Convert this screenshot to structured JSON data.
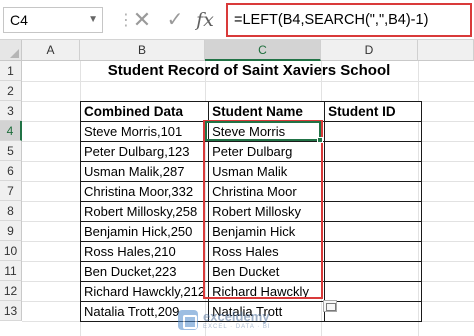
{
  "formula_bar": {
    "name_box": "C4",
    "formula": "=LEFT(B4,SEARCH(\",\",B4)-1)",
    "cancel_icon": "cross-icon",
    "enter_icon": "check-icon",
    "fx_label": "fx"
  },
  "columns": [
    "A",
    "B",
    "C",
    "D"
  ],
  "active_column": "C",
  "rows": [
    "1",
    "2",
    "3",
    "4",
    "5",
    "6",
    "7",
    "8",
    "9",
    "10",
    "11",
    "12",
    "13"
  ],
  "active_row": "4",
  "sheet": {
    "title": "Student Record of Saint Xaviers School",
    "headers": [
      "Combined Data",
      "Student Name",
      "Student ID"
    ],
    "records": [
      {
        "combined": "Steve Morris,101",
        "name": "Steve Morris",
        "id": ""
      },
      {
        "combined": "Peter Dulbarg,123",
        "name": "Peter Dulbarg",
        "id": ""
      },
      {
        "combined": "Usman Malik,287",
        "name": "Usman Malik",
        "id": ""
      },
      {
        "combined": "Christina Moor,332",
        "name": "Christina Moor",
        "id": ""
      },
      {
        "combined": "Robert Millosky,258",
        "name": "Robert Millosky",
        "id": ""
      },
      {
        "combined": "Benjamin Hick,250",
        "name": "Benjamin Hick",
        "id": ""
      },
      {
        "combined": "Ross Hales,210",
        "name": "Ross Hales",
        "id": ""
      },
      {
        "combined": "Ben Ducket,223",
        "name": "Ben Ducket",
        "id": ""
      },
      {
        "combined": "Richard Hawckly,212",
        "name": "Richard Hawckly",
        "id": ""
      },
      {
        "combined": "Natalia Trott,209",
        "name": "Natalia Trott",
        "id": ""
      }
    ]
  },
  "watermark": {
    "name": "exceldemy",
    "tagline": "EXCEL · DATA · BI"
  },
  "colors": {
    "selection_green": "#217346",
    "highlight_red": "#d93a3a"
  }
}
